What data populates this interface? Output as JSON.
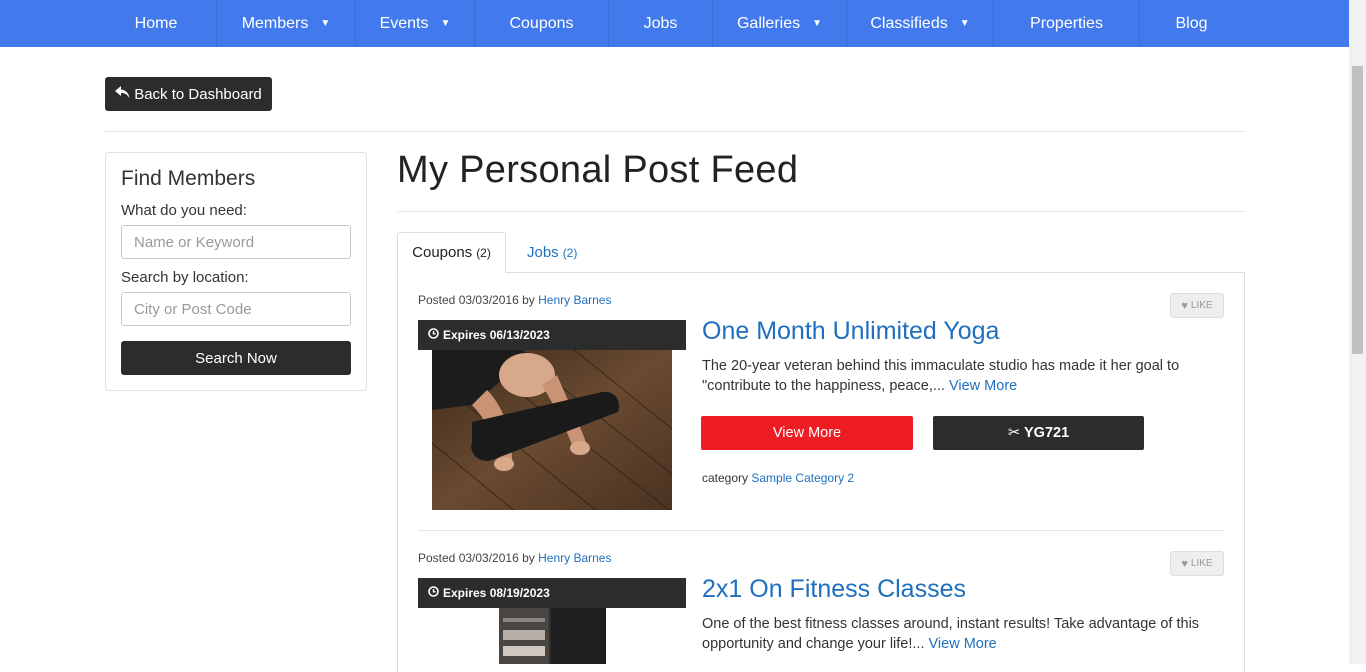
{
  "nav": {
    "items": [
      {
        "label": "Home",
        "dropdown": false
      },
      {
        "label": "Members",
        "dropdown": true
      },
      {
        "label": "Events",
        "dropdown": true
      },
      {
        "label": "Coupons",
        "dropdown": false
      },
      {
        "label": "Jobs",
        "dropdown": false
      },
      {
        "label": "Galleries",
        "dropdown": true
      },
      {
        "label": "Classifieds",
        "dropdown": true
      },
      {
        "label": "Properties",
        "dropdown": false
      },
      {
        "label": "Blog",
        "dropdown": false
      }
    ],
    "caret": "▼"
  },
  "back_button": {
    "label": "Back to Dashboard",
    "icon": "reply-icon"
  },
  "sidebar": {
    "title": "Find Members",
    "keyword_label": "What do you need:",
    "keyword_placeholder": "Name or Keyword",
    "location_label": "Search by location:",
    "location_placeholder": "City or Post Code",
    "search_button": "Search Now"
  },
  "main": {
    "title": "My Personal Post Feed",
    "tabs": [
      {
        "label": "Coupons",
        "count": "(2)",
        "active": true
      },
      {
        "label": "Jobs",
        "count": "(2)",
        "active": false
      }
    ],
    "posts": [
      {
        "posted": "Posted 03/03/2016 by",
        "author": "Henry Barnes",
        "like": "LIKE",
        "expires": "Expires 06/13/2023",
        "title": "One Month Unlimited Yoga",
        "description": "The 20-year veteran behind this immaculate studio has made it her goal to \"contribute to the happiness, peace,...",
        "more": "View More",
        "view_button": "View More",
        "code": "YG721",
        "category_label": "category",
        "category": "Sample Category 2"
      },
      {
        "posted": "Posted 03/03/2016 by",
        "author": "Henry Barnes",
        "like": "LIKE",
        "expires": "Expires 08/19/2023",
        "title": "2x1 On Fitness Classes",
        "description": "One of the best fitness classes around, instant results! Take advantage of this opportunity and change your life!...",
        "more": "View More"
      }
    ]
  },
  "colors": {
    "nav_bg": "#4279ec",
    "dark_button": "#2c2c2c",
    "accent_red": "#ee1c23",
    "link_blue": "#1f6fbf"
  }
}
